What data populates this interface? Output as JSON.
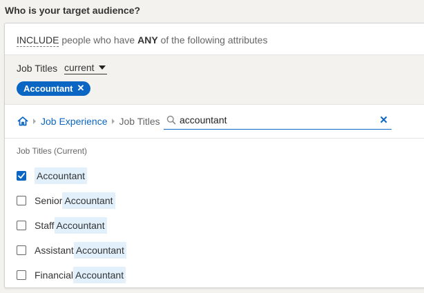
{
  "heading": "Who is your target audience?",
  "include": {
    "word": "INCLUDE",
    "mid": "people who have",
    "any": "ANY",
    "end": "of the following attributes"
  },
  "attribute": {
    "label": "Job Titles",
    "select_value": "current",
    "chips": [
      {
        "label": "Accountant"
      }
    ]
  },
  "breadcrumb": {
    "items": [
      "Job Experience",
      "Job Titles"
    ]
  },
  "search": {
    "value": "accountant",
    "placeholder": ""
  },
  "results": {
    "title": "Job Titles (Current)",
    "options": [
      {
        "prefix": "",
        "match": "Accountant",
        "checked": true
      },
      {
        "prefix": "Senior",
        "match": "Accountant",
        "checked": false
      },
      {
        "prefix": "Staff",
        "match": "Accountant",
        "checked": false
      },
      {
        "prefix": "Assistant",
        "match": "Accountant",
        "checked": false
      },
      {
        "prefix": "Financial",
        "match": "Accountant",
        "checked": false
      }
    ]
  },
  "colors": {
    "accent": "#0a66c2",
    "highlight": "#e1f0fb",
    "section_bg": "#f3f2ef"
  },
  "icons": [
    "home-icon",
    "chevron-right-icon",
    "search-icon",
    "close-icon",
    "caret-down-icon",
    "checkmark-icon"
  ]
}
